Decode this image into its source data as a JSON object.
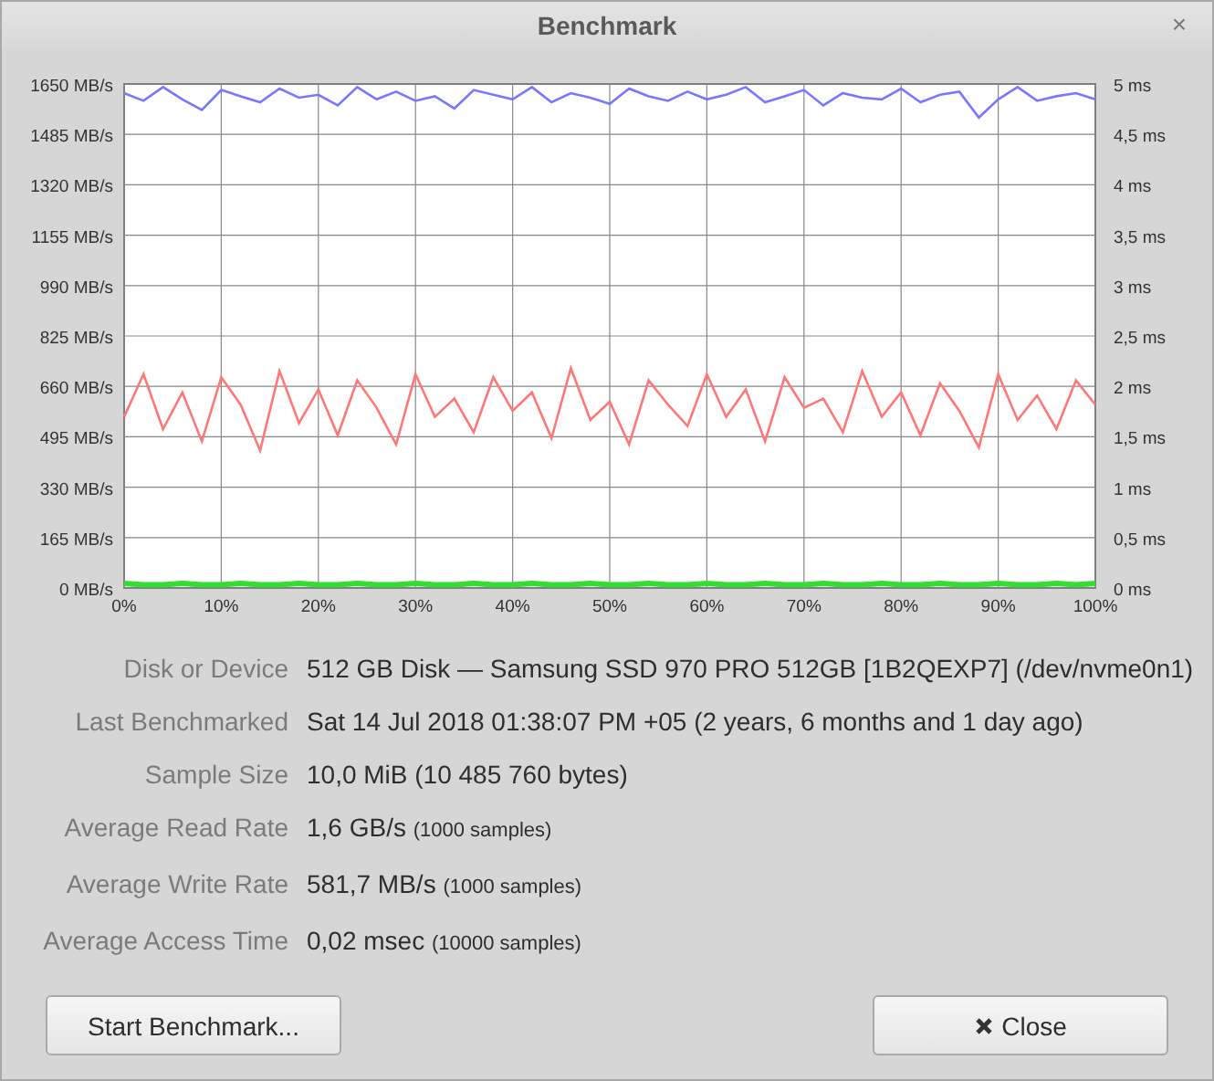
{
  "window": {
    "title": "Benchmark",
    "close": "×"
  },
  "chart": {
    "chart_data": {
      "type": "line",
      "ylim": [
        0,
        1650
      ],
      "xlim": [
        0,
        100
      ],
      "x": [
        0,
        2,
        4,
        6,
        8,
        10,
        12,
        14,
        16,
        18,
        20,
        22,
        24,
        26,
        28,
        30,
        32,
        34,
        36,
        38,
        40,
        42,
        44,
        46,
        48,
        50,
        52,
        54,
        56,
        58,
        60,
        62,
        64,
        66,
        68,
        70,
        72,
        74,
        76,
        78,
        80,
        82,
        84,
        86,
        88,
        90,
        92,
        94,
        96,
        98,
        100
      ],
      "yticks": [
        {
          "value": 0,
          "label": "0 MB/s"
        },
        {
          "value": 165,
          "label": "165 MB/s"
        },
        {
          "value": 330,
          "label": "330 MB/s"
        },
        {
          "value": 495,
          "label": "495 MB/s"
        },
        {
          "value": 660,
          "label": "660 MB/s"
        },
        {
          "value": 825,
          "label": "825 MB/s"
        },
        {
          "value": 990,
          "label": "990 MB/s"
        },
        {
          "value": 1155,
          "label": "1155 MB/s"
        },
        {
          "value": 1320,
          "label": "1320 MB/s"
        },
        {
          "value": 1485,
          "label": "1485 MB/s"
        },
        {
          "value": 1650,
          "label": "1650 MB/s"
        }
      ],
      "xticks": [
        {
          "value": 0,
          "label": "0%"
        },
        {
          "value": 10,
          "label": "10%"
        },
        {
          "value": 20,
          "label": "20%"
        },
        {
          "value": 30,
          "label": "30%"
        },
        {
          "value": 40,
          "label": "40%"
        },
        {
          "value": 50,
          "label": "50%"
        },
        {
          "value": 60,
          "label": "60%"
        },
        {
          "value": 70,
          "label": "70%"
        },
        {
          "value": 80,
          "label": "80%"
        },
        {
          "value": 90,
          "label": "90%"
        },
        {
          "value": 100,
          "label": "100%"
        }
      ],
      "series": [
        {
          "color": "#7777ff",
          "values": [
            1620,
            1595,
            1640,
            1600,
            1565,
            1630,
            1610,
            1590,
            1635,
            1605,
            1615,
            1580,
            1640,
            1600,
            1625,
            1595,
            1610,
            1570,
            1630,
            1615,
            1600,
            1640,
            1590,
            1620,
            1605,
            1585,
            1635,
            1610,
            1595,
            1625,
            1600,
            1615,
            1640,
            1590,
            1610,
            1630,
            1580,
            1620,
            1605,
            1600,
            1635,
            1590,
            1615,
            1625,
            1540,
            1600,
            1640,
            1595,
            1610,
            1620,
            1600
          ]
        },
        {
          "color": "#ff7777",
          "values": [
            560,
            700,
            520,
            640,
            480,
            690,
            600,
            450,
            710,
            540,
            650,
            500,
            680,
            590,
            470,
            700,
            560,
            620,
            510,
            690,
            580,
            640,
            490,
            720,
            550,
            610,
            470,
            680,
            600,
            530,
            700,
            560,
            650,
            480,
            690,
            590,
            620,
            510,
            710,
            560,
            640,
            500,
            670,
            580,
            460,
            700,
            550,
            630,
            520,
            680,
            600
          ]
        },
        {
          "color": "#33dd33",
          "values": [
            15,
            10,
            10,
            15,
            10,
            10,
            15,
            10,
            10,
            15,
            10,
            10,
            15,
            10,
            10,
            15,
            10,
            10,
            15,
            10,
            10,
            15,
            10,
            10,
            15,
            10,
            10,
            15,
            10,
            10,
            15,
            10,
            10,
            15,
            10,
            10,
            15,
            10,
            10,
            15,
            10,
            10,
            15,
            10,
            10,
            15,
            10,
            10,
            15,
            10,
            15
          ]
        }
      ],
      "grid": true
    },
    "right_ticks": [
      "5 ms",
      "4,5 ms",
      "4 ms",
      "3,5 ms",
      "3 ms",
      "2,5 ms",
      "2 ms",
      "1,5 ms",
      "1 ms",
      "0,5 ms",
      "0 ms"
    ]
  },
  "details": [
    {
      "label": "Disk or Device",
      "value": "512 GB Disk — Samsung SSD 970 PRO 512GB [1B2QEXP7] (/dev/nvme0n1)"
    },
    {
      "label": "Last Benchmarked",
      "value": "Sat 14 Jul 2018 01:38:07 PM +05 (2 years, 6 months and 1 day ago)"
    },
    {
      "label": "Sample Size",
      "value": "10,0 MiB (10 485 760 bytes)"
    },
    {
      "label": "Average Read Rate",
      "value": "1,6 GB/s",
      "note": "(1000 samples)"
    },
    {
      "label": "Average Write Rate",
      "value": "581,7 MB/s",
      "note": "(1000 samples)"
    },
    {
      "label": "Average Access Time",
      "value": "0,02 msec",
      "note": "(10000 samples)"
    }
  ],
  "buttons": [
    {
      "label": "Start Benchmark...",
      "kind": "plain"
    },
    {
      "label": "Close",
      "kind": "close"
    }
  ]
}
